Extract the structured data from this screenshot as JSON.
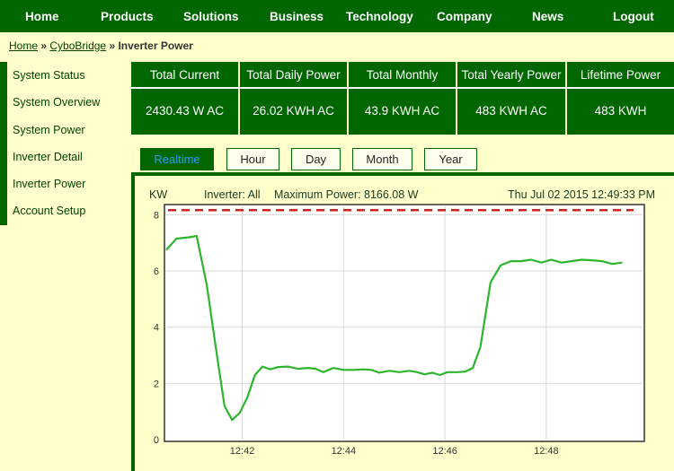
{
  "nav": {
    "items": [
      "Home",
      "Products",
      "Solutions",
      "Business",
      "Technology",
      "Company",
      "News",
      "Logout"
    ]
  },
  "breadcrumb": {
    "home": "Home",
    "sep": "»",
    "cybobridge": "CyboBridge",
    "current": "Inverter Power"
  },
  "sidebar": {
    "items": [
      "System Status",
      "System Overview",
      "System Power",
      "Inverter Detail",
      "Inverter Power",
      "Account Setup"
    ]
  },
  "stats": [
    {
      "label": "Total Current",
      "value": "2430.43 W AC"
    },
    {
      "label": "Total Daily Power",
      "value": "26.02 KWH AC"
    },
    {
      "label": "Total Monthly",
      "value": "43.9 KWH AC"
    },
    {
      "label": "Total Yearly Power",
      "value": "483 KWH AC"
    },
    {
      "label": "Lifetime Power",
      "value": "483 KWH"
    }
  ],
  "tabs": [
    "Realtime",
    "Hour",
    "Day",
    "Month",
    "Year"
  ],
  "active_tab": "Realtime",
  "chart_header": {
    "unit": "KW",
    "inverter": "Inverter: All",
    "max_power": "Maximum Power: 8166.08 W",
    "timestamp": "Thu Jul 02 2015 12:49:33 PM"
  },
  "colors": {
    "nav_green": "#006600",
    "background": "#ffffcc",
    "line_green": "#2db52d",
    "max_line_red": "#cc2222",
    "active_tab_text": "#3399ff"
  },
  "chart_data": {
    "type": "line",
    "ylabel": "KW",
    "ylim": [
      0,
      8.3
    ],
    "yticks": [
      0,
      2,
      4,
      6,
      8
    ],
    "ytick_labels": [
      "0",
      "2",
      "4",
      "6",
      "8"
    ],
    "xlim": [
      40.5,
      49.9
    ],
    "xticks": [
      42,
      44,
      46,
      48
    ],
    "xtick_labels": [
      "12:42",
      "12:44",
      "12:46",
      "12:48"
    ],
    "grid": true,
    "max_power_line": 8.166,
    "series": [
      {
        "x": [
          40.5,
          40.7,
          40.95,
          41.1,
          41.3,
          41.5,
          41.65,
          41.8,
          41.95,
          42.1,
          42.25,
          42.4,
          42.55,
          42.7,
          42.9,
          43.1,
          43.3,
          43.45,
          43.6,
          43.8,
          44.0,
          44.2,
          44.4,
          44.55,
          44.7,
          44.9,
          45.1,
          45.3,
          45.45,
          45.6,
          45.75,
          45.9,
          46.05,
          46.15,
          46.25,
          46.4,
          46.55,
          46.7,
          46.9,
          47.1,
          47.3,
          47.5,
          47.7,
          47.9,
          48.1,
          48.3,
          48.5,
          48.7,
          48.9,
          49.1,
          49.3,
          49.5
        ],
        "y": [
          6.75,
          7.15,
          7.2,
          7.25,
          5.5,
          3.0,
          1.2,
          0.7,
          0.95,
          1.5,
          2.3,
          2.6,
          2.5,
          2.58,
          2.6,
          2.52,
          2.55,
          2.52,
          2.4,
          2.55,
          2.48,
          2.48,
          2.5,
          2.48,
          2.38,
          2.45,
          2.4,
          2.45,
          2.4,
          2.32,
          2.38,
          2.3,
          2.4,
          2.4,
          2.4,
          2.42,
          2.55,
          3.3,
          5.6,
          6.2,
          6.35,
          6.35,
          6.4,
          6.3,
          6.4,
          6.3,
          6.35,
          6.4,
          6.38,
          6.35,
          6.25,
          6.3
        ]
      }
    ]
  }
}
